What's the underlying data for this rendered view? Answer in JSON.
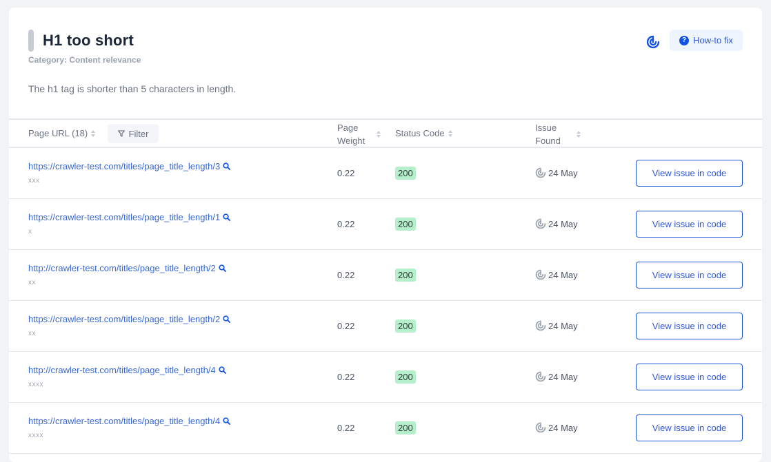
{
  "issue": {
    "title": "H1 too short",
    "category": "Category: Content relevance",
    "description": "The h1 tag is shorter than 5 characters in length.",
    "howto_label": "How-to fix"
  },
  "table": {
    "headers": {
      "page_url": "Page URL (18)",
      "filter": "Filter",
      "page_weight_line1": "Page",
      "page_weight_line2": "Weight",
      "status_code": "Status Code",
      "issue_found_line1": "Issue",
      "issue_found_line2": "Found"
    },
    "rows": [
      {
        "url": "https://crawler-test.com/titles/page_title_length/3",
        "h1": "xxx",
        "weight": "0.22",
        "status": "200",
        "found": "24 May",
        "action": "View issue in code"
      },
      {
        "url": "https://crawler-test.com/titles/page_title_length/1",
        "h1": "x",
        "weight": "0.22",
        "status": "200",
        "found": "24 May",
        "action": "View issue in code"
      },
      {
        "url": "http://crawler-test.com/titles/page_title_length/2",
        "h1": "xx",
        "weight": "0.22",
        "status": "200",
        "found": "24 May",
        "action": "View issue in code"
      },
      {
        "url": "https://crawler-test.com/titles/page_title_length/2",
        "h1": "xx",
        "weight": "0.22",
        "status": "200",
        "found": "24 May",
        "action": "View issue in code"
      },
      {
        "url": "http://crawler-test.com/titles/page_title_length/4",
        "h1": "xxxx",
        "weight": "0.22",
        "status": "200",
        "found": "24 May",
        "action": "View issue in code"
      },
      {
        "url": "https://crawler-test.com/titles/page_title_length/4",
        "h1": "xxxx",
        "weight": "0.22",
        "status": "200",
        "found": "24 May",
        "action": "View issue in code"
      }
    ]
  },
  "colors": {
    "accent": "#1251e6",
    "link": "#3767d8",
    "status_ok_bg": "#b5efcc"
  }
}
